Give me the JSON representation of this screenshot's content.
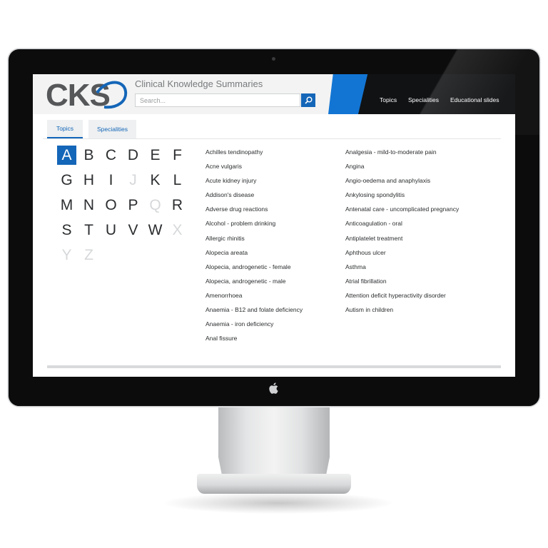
{
  "site": {
    "logo_text": "CKS",
    "title": "Clinical Knowledge Summaries"
  },
  "search": {
    "placeholder": "Search...",
    "button_icon": "search-icon"
  },
  "nav": {
    "items": [
      {
        "label": "Topics"
      },
      {
        "label": "Specialities"
      },
      {
        "label": "Educational slides"
      }
    ]
  },
  "tabs": [
    {
      "label": "Topics",
      "active": true
    },
    {
      "label": "Specialities",
      "active": false
    }
  ],
  "alphabet": [
    {
      "letter": "A",
      "state": "active"
    },
    {
      "letter": "B",
      "state": "enabled"
    },
    {
      "letter": "C",
      "state": "enabled"
    },
    {
      "letter": "D",
      "state": "enabled"
    },
    {
      "letter": "E",
      "state": "enabled"
    },
    {
      "letter": "F",
      "state": "enabled"
    },
    {
      "letter": "G",
      "state": "enabled"
    },
    {
      "letter": "H",
      "state": "enabled"
    },
    {
      "letter": "I",
      "state": "enabled"
    },
    {
      "letter": "J",
      "state": "disabled"
    },
    {
      "letter": "K",
      "state": "enabled"
    },
    {
      "letter": "L",
      "state": "enabled"
    },
    {
      "letter": "M",
      "state": "enabled"
    },
    {
      "letter": "N",
      "state": "enabled"
    },
    {
      "letter": "O",
      "state": "enabled"
    },
    {
      "letter": "P",
      "state": "enabled"
    },
    {
      "letter": "Q",
      "state": "disabled"
    },
    {
      "letter": "R",
      "state": "enabled"
    },
    {
      "letter": "S",
      "state": "enabled"
    },
    {
      "letter": "T",
      "state": "enabled"
    },
    {
      "letter": "U",
      "state": "enabled"
    },
    {
      "letter": "V",
      "state": "enabled"
    },
    {
      "letter": "W",
      "state": "enabled"
    },
    {
      "letter": "X",
      "state": "disabled"
    },
    {
      "letter": "Y",
      "state": "disabled"
    },
    {
      "letter": "Z",
      "state": "disabled"
    }
  ],
  "topics": {
    "column1": [
      "Achilles tendinopathy",
      "Acne vulgaris",
      "Acute kidney injury",
      "Addison's disease",
      "Adverse drug reactions",
      "Alcohol - problem drinking",
      "Allergic rhinitis",
      "Alopecia areata",
      "Alopecia, androgenetic - female",
      "Alopecia, androgenetic - male",
      "Amenorrhoea",
      "Anaemia - B12 and folate deficiency",
      "Anaemia - iron deficiency",
      "Anal fissure"
    ],
    "column2": [
      "Analgesia - mild-to-moderate pain",
      "Angina",
      "Angio-oedema and anaphylaxis",
      "Ankylosing spondylitis",
      "Antenatal care - uncomplicated pregnancy",
      "Anticoagulation - oral",
      "Antiplatelet treatment",
      "Aphthous ulcer",
      "Asthma",
      "Atrial fibrillation",
      "Attention deficit hyperactivity disorder",
      "Autism in children"
    ]
  },
  "colors": {
    "brand_blue": "#1466b8",
    "header_accent_blue": "#1275d3",
    "header_dark": "#111214",
    "bezel": "#0c0c0d"
  },
  "device": {
    "logo_icon": "apple-logo-icon"
  }
}
